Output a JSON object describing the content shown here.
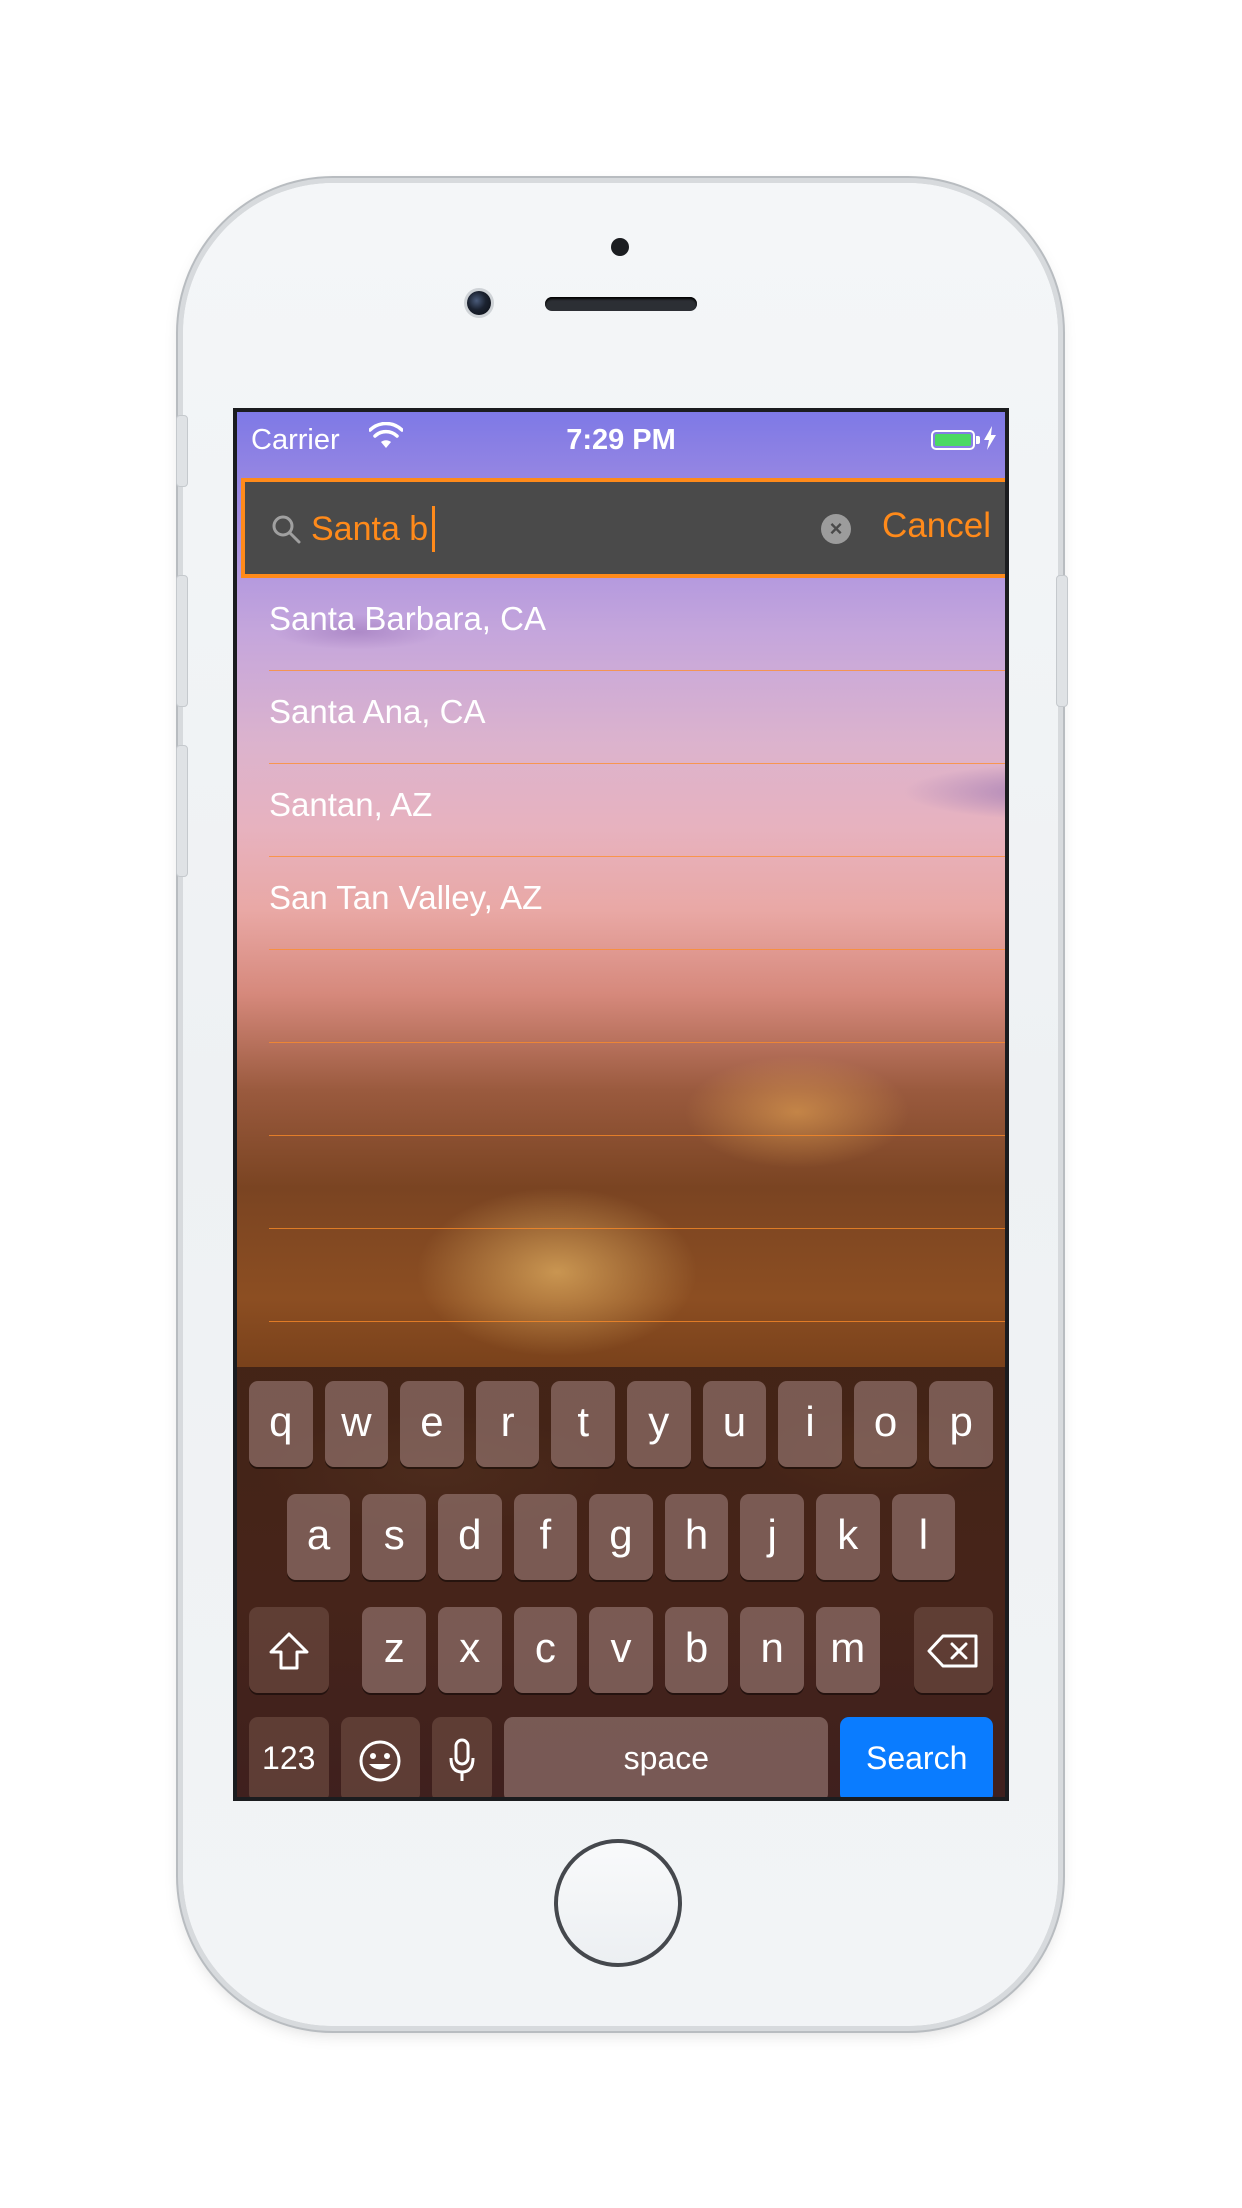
{
  "status_bar": {
    "carrier": "Carrier",
    "time": "7:29 PM",
    "wifi_icon": "wifi-icon",
    "battery_icon": "battery-icon",
    "charging_icon": "bolt-icon",
    "battery_color": "#4cd964"
  },
  "search": {
    "value": "Santa b",
    "icon": "search-icon",
    "clear_icon": "clear-icon",
    "cancel_label": "Cancel",
    "accent_color": "#ff8a1a"
  },
  "results": [
    {
      "label": "Santa Barbara, CA"
    },
    {
      "label": "Santa Ana, CA"
    },
    {
      "label": "Santan, AZ"
    },
    {
      "label": "San Tan Valley, AZ"
    },
    {
      "label": ""
    },
    {
      "label": ""
    },
    {
      "label": ""
    },
    {
      "label": ""
    }
  ],
  "keyboard": {
    "row1": [
      "q",
      "w",
      "e",
      "r",
      "t",
      "y",
      "u",
      "i",
      "o",
      "p"
    ],
    "row2": [
      "a",
      "s",
      "d",
      "f",
      "g",
      "h",
      "j",
      "k",
      "l"
    ],
    "row3": [
      "z",
      "x",
      "c",
      "v",
      "b",
      "n",
      "m"
    ],
    "numbers_label": "123",
    "space_label": "space",
    "search_label": "Search",
    "shift_icon": "shift-icon",
    "delete_icon": "delete-icon",
    "emoji_icon": "emoji-icon",
    "mic_icon": "mic-icon",
    "search_key_color": "#0a7cff"
  }
}
